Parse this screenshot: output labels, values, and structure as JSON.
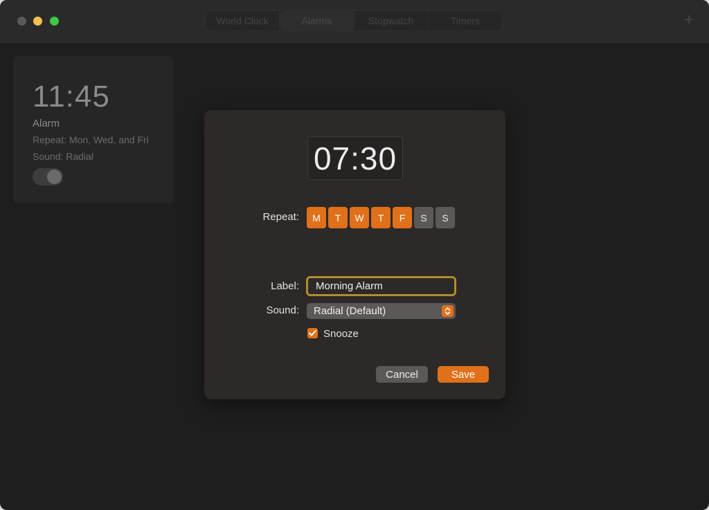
{
  "titlebar": {
    "tabs": [
      {
        "label": "World Clock"
      },
      {
        "label": "Alarms"
      },
      {
        "label": "Stopwatch"
      },
      {
        "label": "Timers"
      }
    ],
    "add_label": "+"
  },
  "alarm_card": {
    "time": "11:45",
    "title": "Alarm",
    "repeat": "Repeat: Mon, Wed, and Fri",
    "sound": "Sound: Radial",
    "enabled": true
  },
  "dialog": {
    "time": "07:30",
    "repeat_label": "Repeat:",
    "days": [
      {
        "letter": "M",
        "selected": true
      },
      {
        "letter": "T",
        "selected": true
      },
      {
        "letter": "W",
        "selected": true
      },
      {
        "letter": "T",
        "selected": true
      },
      {
        "letter": "F",
        "selected": true
      },
      {
        "letter": "S",
        "selected": false
      },
      {
        "letter": "S",
        "selected": false
      }
    ],
    "label_label": "Label:",
    "label_value": "Morning Alarm",
    "sound_label": "Sound:",
    "sound_value": "Radial (Default)",
    "snooze_label": "Snooze",
    "snooze_checked": true,
    "cancel_label": "Cancel",
    "save_label": "Save"
  },
  "colors": {
    "accent": "#e0711a",
    "focus_ring": "#b08e2c",
    "dialog_bg": "#2c2928",
    "window_bg": "#1e1e1e"
  }
}
